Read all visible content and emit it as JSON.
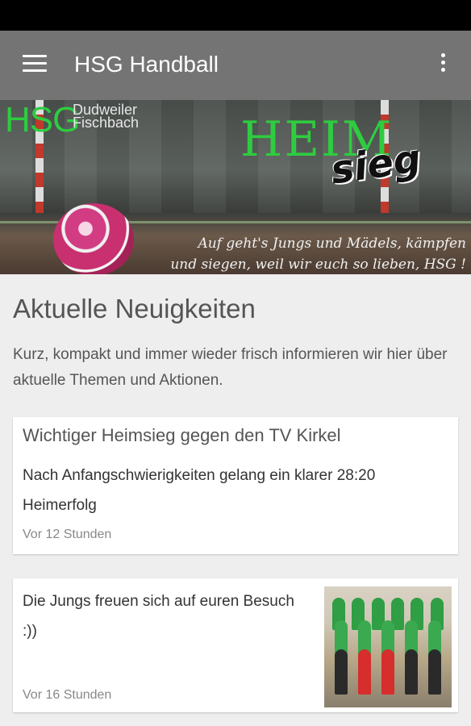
{
  "appbar": {
    "title": "HSG Handball",
    "menu_icon": "hamburger-menu-icon",
    "overflow_icon": "more-vert-icon"
  },
  "banner": {
    "logo_main": "HSG",
    "logo_line1": "Dudweiler",
    "logo_line2": "Fischbach",
    "headline_part1": "HEIM",
    "headline_part2": "sieg",
    "slogan_line1": "Auf geht's Jungs und Mädels, kämpfen",
    "slogan_line2": "und siegen, weil wir euch so lieben, HSG !"
  },
  "section": {
    "title": "Aktuelle Neuigkeiten",
    "intro": "Kurz, kompakt und immer wieder frisch informieren wir hier über aktuelle Themen und Aktionen."
  },
  "news": [
    {
      "title": "Wichtiger Heimsieg gegen den TV Kirkel",
      "text": "Nach Anfangschwierigkeiten gelang ein klarer 28:20 Heimerfolg",
      "time": "Vor 12 Stunden"
    },
    {
      "text": "Die Jungs freuen sich auf euren Besuch :))",
      "time": "Vor 16 Stunden"
    }
  ],
  "colors": {
    "appbar": "#747474",
    "statusbar": "#000000",
    "accent_green": "#2ecc40",
    "background": "#eeeeee"
  }
}
